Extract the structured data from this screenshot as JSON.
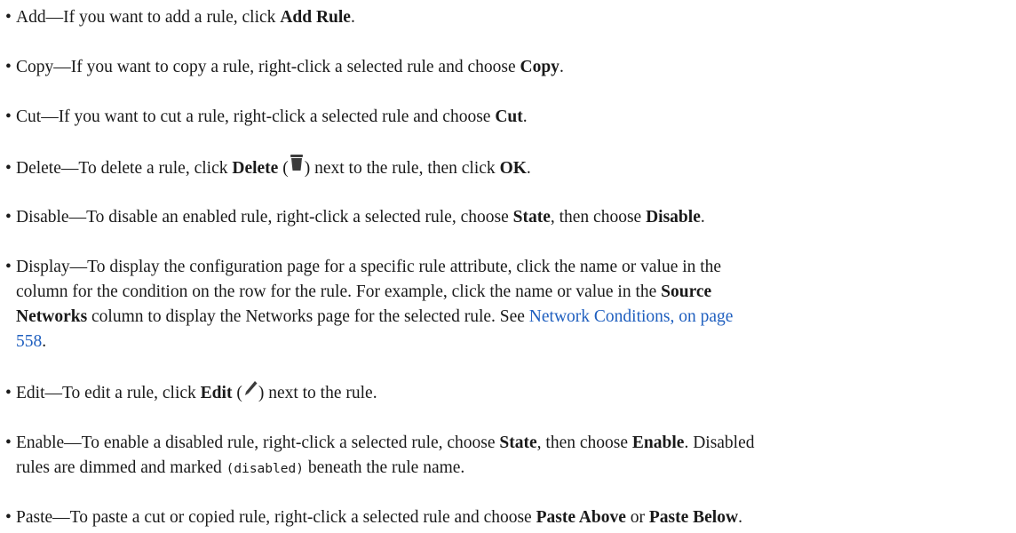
{
  "bullet": "•",
  "open_paren": "(",
  "close_paren": ")",
  "items": [
    {
      "term": "Add",
      "text": "—If you want to add a rule, click ",
      "b1": "Add Rule",
      "tail": "."
    },
    {
      "term": "Copy",
      "text": "—If you want to copy a rule, right-click a selected rule and choose ",
      "b1": "Copy",
      "tail": "."
    },
    {
      "term": "Cut",
      "text": "—If you want to cut a rule, right-click a selected rule and choose ",
      "b1": "Cut",
      "tail": "."
    },
    {
      "term": "Delete",
      "text": "—To delete a rule, click ",
      "b1": "Delete",
      "icon": "trash-icon",
      "mid": " next to the rule, then click ",
      "b2": "OK",
      "tail": "."
    },
    {
      "term": "Disable",
      "text": "—To disable an enabled rule, right-click a selected rule, choose ",
      "b1": "State",
      "mid": ", then choose ",
      "b2": "Disable",
      "tail": "."
    },
    {
      "term": "Display",
      "line1": "—To display the configuration page for a specific rule attribute, click the name or value in the",
      "line2a": "column for the condition on the row for the rule. For example, click the name or value in the ",
      "b1": "Source",
      "b2": "Networks",
      "line3a": " column to display the Networks page for the selected rule. See ",
      "link_line3": "Network Conditions, on page",
      "link_line4": "558",
      "tail": "."
    },
    {
      "term": "Edit",
      "text": "—To edit a rule, click ",
      "b1": "Edit",
      "icon": "pencil-icon",
      "mid": " next to the rule."
    },
    {
      "term": "Enable",
      "text": "—To enable a disabled rule, right-click a selected rule, choose ",
      "b1": "State",
      "mid": ", then choose ",
      "b2": "Enable",
      "tail": ". Disabled",
      "line2a": "rules are dimmed and marked ",
      "code": "(disabled)",
      "line2b": " beneath the rule name."
    },
    {
      "term": "Paste",
      "text": "—To paste a cut or copied rule, right-click a selected rule and choose ",
      "b1": "Paste Above",
      "mid": " or ",
      "b2": "Paste Below",
      "tail": "."
    }
  ],
  "colors": {
    "text": "#1a1a1a",
    "link": "#1f5fbf",
    "icon": "#3c3c3c"
  }
}
